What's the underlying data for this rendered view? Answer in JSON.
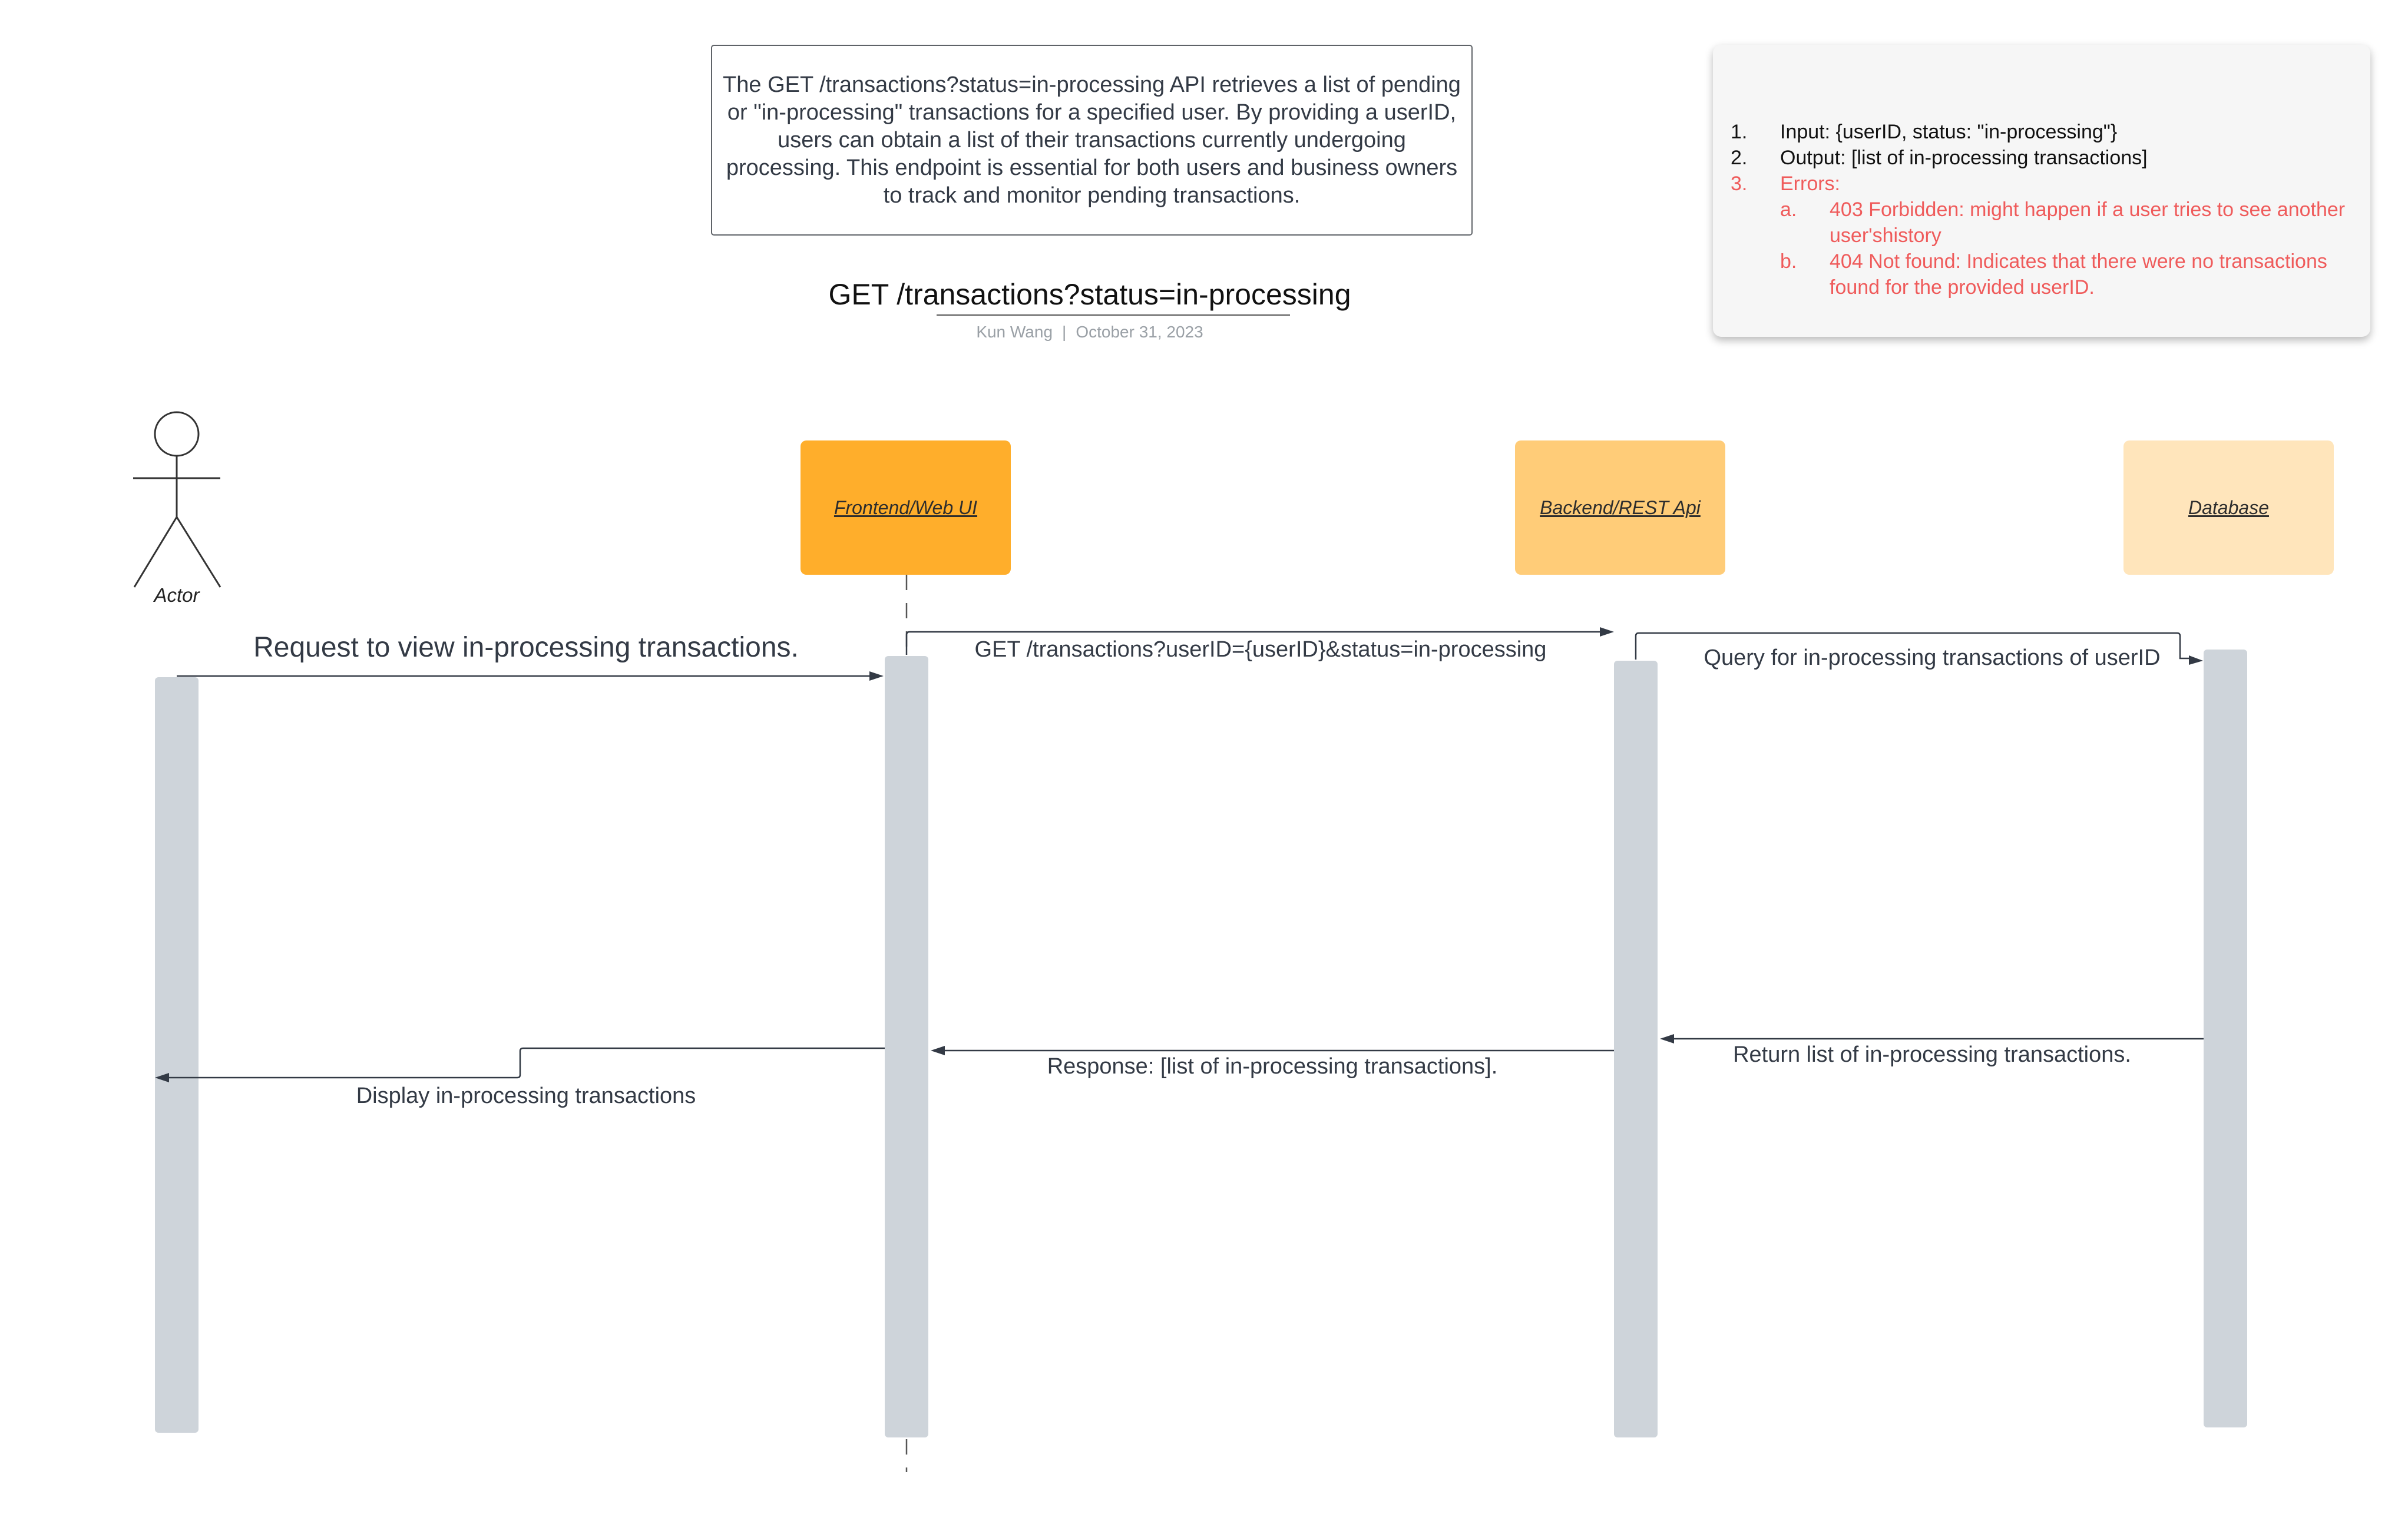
{
  "description": "The GET /transactions?status=in-processing API retrieves a list of pending or \"in-processing\" transactions for a specified user. By providing a userID, users can obtain a list of their transactions currently undergoing processing. This endpoint is essential for both users and business owners to track and monitor pending transactions.",
  "title": "GET /transactions?status=in-processing",
  "author": "Kun Wang",
  "separator": "|",
  "date": "October 31, 2023",
  "notes": {
    "items": [
      {
        "num": "1.",
        "text": "Input: {userID, status: \"in-processing\"}"
      },
      {
        "num": "2.",
        "text": "Output: [list of in-processing transactions]"
      },
      {
        "num": "3.",
        "text": "Errors:"
      }
    ],
    "errors": [
      {
        "num": "a.",
        "text": "403 Forbidden:  might happen if a user tries to see another user'shistory"
      },
      {
        "num": "b.",
        "text": "404 Not found:  Indicates that there were no transactions found for the provided userID."
      }
    ]
  },
  "participants": {
    "actor": "Actor",
    "frontend": "Frontend/Web UI",
    "backend": "Backend/REST Api",
    "database": "Database"
  },
  "messages": {
    "m1": "Request to view in-processing transactions.",
    "m2": "GET /transactions?userID={userID}&status=in-processing",
    "m3": "Query for in-processing transactions of userID",
    "m4": "Return list of in-processing transactions.",
    "m5": "Response: [list of in-processing transactions].",
    "m6": "Display in-processing transactions"
  },
  "colors": {
    "frontend": "#ffae2b",
    "backend": "#ffcc78",
    "database": "#ffe5bb",
    "activation": "#ced4da",
    "arrow": "#333a45",
    "error_text": "#ef5b5b"
  }
}
